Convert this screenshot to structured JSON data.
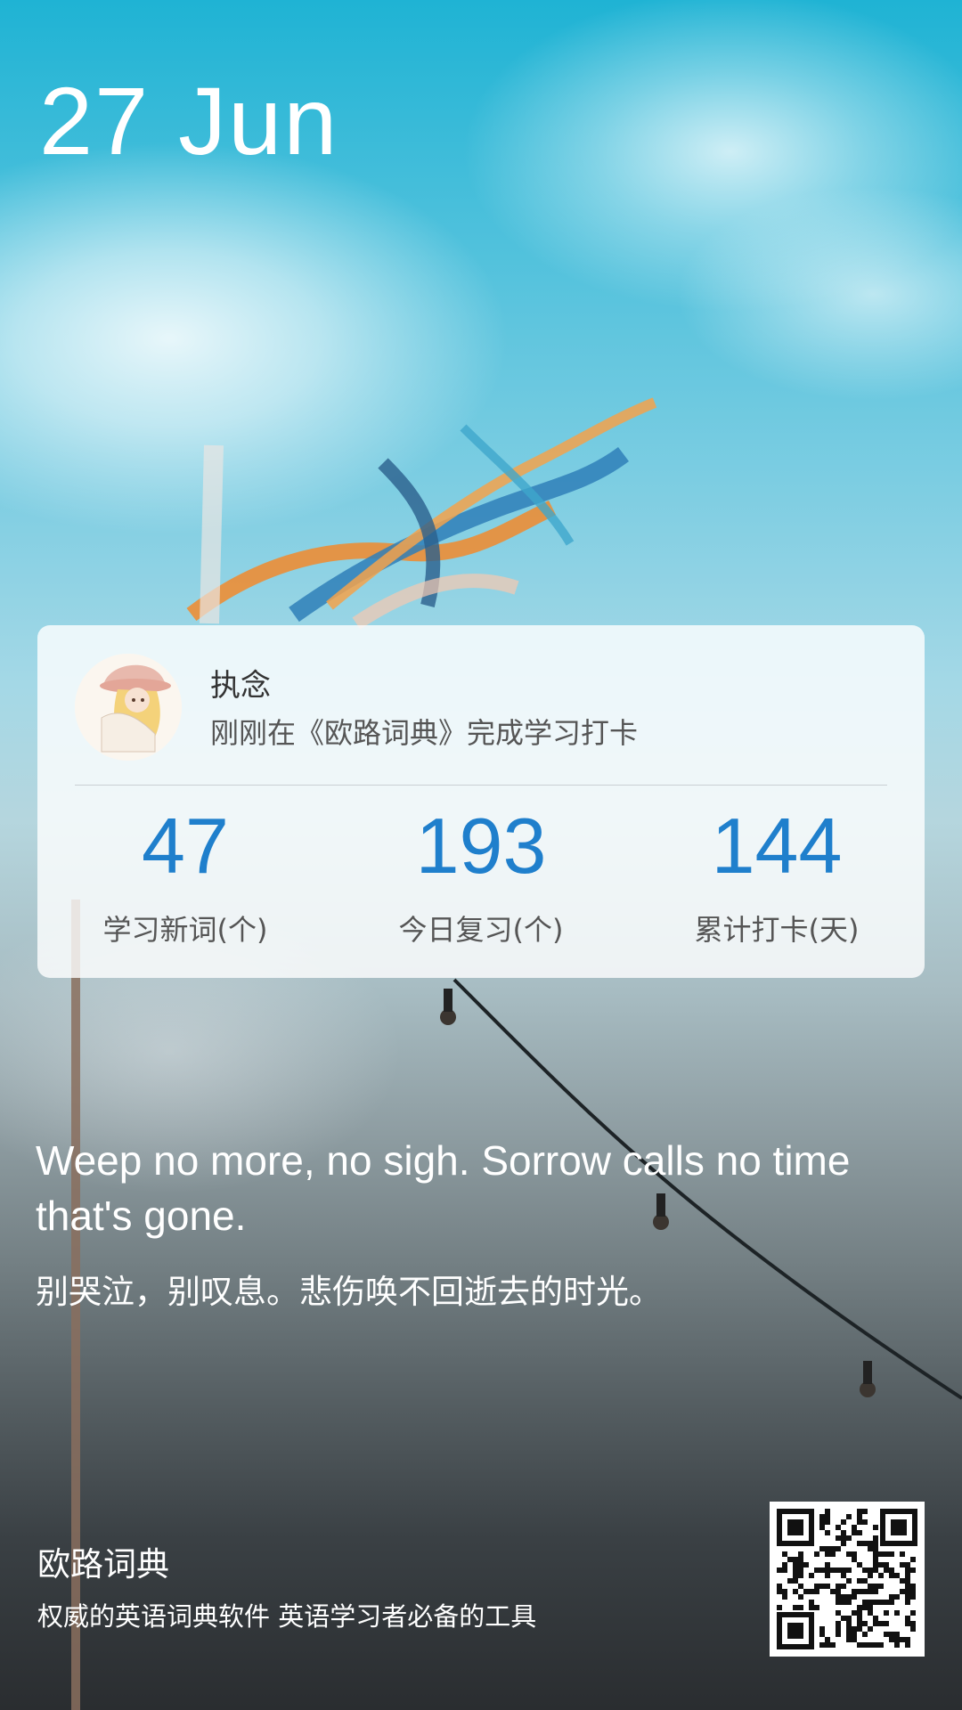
{
  "header": {
    "date": "27 Jun"
  },
  "card": {
    "username": "执念",
    "subtitle": "刚刚在《欧路词典》完成学习打卡",
    "stats": [
      {
        "value": "47",
        "label": "学习新词(个)"
      },
      {
        "value": "193",
        "label": "今日复习(个)"
      },
      {
        "value": "144",
        "label": "累计打卡(天)"
      }
    ]
  },
  "quote": {
    "english": "Weep no more, no sigh. Sorrow calls no time that's gone.",
    "chinese": "别哭泣，别叹息。悲伤唤不回逝去的时光。"
  },
  "footer": {
    "brand": "欧路词典",
    "slogan": "权威的英语词典软件 英语学习者必备的工具"
  },
  "icons": {
    "avatar": "anime-girl-avatar",
    "qr": "qr-code"
  },
  "colors": {
    "accent": "#1f7fcc"
  }
}
